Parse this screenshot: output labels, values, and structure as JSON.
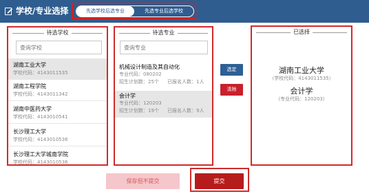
{
  "header": {
    "title": "学校/专业选择",
    "icon": "edit-icon",
    "modes": [
      "先选学校后选专业",
      "先选专业后选学校"
    ],
    "active_mode": 0,
    "bg_color": "#2f5d8f"
  },
  "schools": {
    "legend": "待选学校",
    "search_placeholder": "查询学校",
    "items": [
      {
        "name": "湖南工业大学",
        "code": "学校代码：4143011535",
        "selected": true
      },
      {
        "name": "湖南工程学院",
        "code": "学校代码：4143011342",
        "selected": false
      },
      {
        "name": "湖南中医药大学",
        "code": "学校代码：4143010541",
        "selected": false
      },
      {
        "name": "长沙理工大学",
        "code": "学校代码：4143010536",
        "selected": false
      },
      {
        "name": "长沙理工大学城南学院",
        "code": "学校代码：4143010536",
        "selected": false
      }
    ]
  },
  "majors": {
    "legend": "待选专业",
    "search_placeholder": "查询专业",
    "items": [
      {
        "name": "机械设计制造及其自动化",
        "code": "专业代码：080202",
        "plan": "招生计划数：25个",
        "applied": "已报名人数：1人",
        "selected": false
      },
      {
        "name": "会计学",
        "code": "专业代码：120203",
        "plan": "招生计划数：19个",
        "applied": "已报名人数：9人",
        "selected": true
      }
    ]
  },
  "actions": {
    "select_label": "选定",
    "clear_label": "清除"
  },
  "selected": {
    "legend": "已选择",
    "school": "湖南工业大学",
    "school_code": "（学校代码：4143011535）",
    "major": "会计学",
    "major_code": "（专业代码：120203）"
  },
  "footer": {
    "save_label": "保存但不提交",
    "submit_label": "提交"
  },
  "colors": {
    "accent": "#2f5d8f",
    "highlight_border": "#cf2a2a",
    "danger": "#c8202c",
    "submit": "#b71c1c"
  }
}
